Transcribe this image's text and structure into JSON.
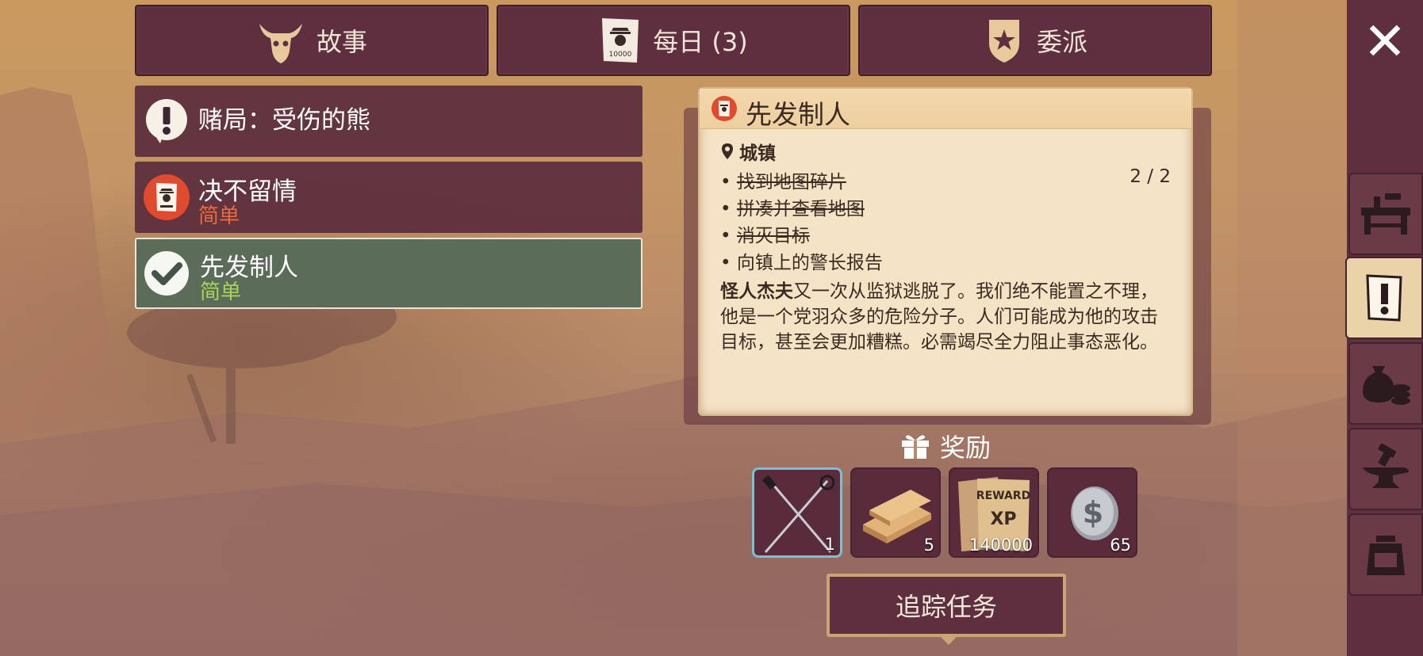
{
  "tabs": [
    {
      "label": "故事",
      "icon": "bull-skull-icon"
    },
    {
      "label": "每日 (3)",
      "icon": "wanted-poster-icon"
    },
    {
      "label": "委派",
      "icon": "sheriff-badge-icon"
    }
  ],
  "close": {
    "symbol": "✕"
  },
  "quests": [
    {
      "title": "赌局：受伤的熊",
      "subtitle": "",
      "icon": "exclamation-icon",
      "state": "normal"
    },
    {
      "title": "决不留情",
      "subtitle": "简单",
      "subtitle_color": "#e96a3e",
      "icon": "wanted-poster-icon",
      "state": "normal"
    },
    {
      "title": "先发制人",
      "subtitle": "简单",
      "subtitle_color": "#a9d45a",
      "icon": "checkmark-icon",
      "state": "selected"
    }
  ],
  "detail": {
    "title": "先发制人",
    "location": "城镇",
    "objectives": [
      {
        "text": "找到地图碎片",
        "done": true
      },
      {
        "text": "拼凑并查看地图",
        "done": true
      },
      {
        "text": "消灭目标",
        "done": true
      },
      {
        "text": "向镇上的警长报告",
        "done": false
      }
    ],
    "objective_count": "2 / 2",
    "description_name": "怪人杰夫",
    "description_rest": "又一次从监狱逃脱了。我们绝不能置之不理，他是一个党羽众多的危险分子。人们可能成为他的攻击目标，甚至会更加糟糕。必需竭尽全力阻止事态恶化。"
  },
  "rewards": {
    "label": "奖励",
    "items": [
      {
        "name": "sabers-icon",
        "qty": "1"
      },
      {
        "name": "wood-planks-icon",
        "qty": "5"
      },
      {
        "name": "xp-reward-poster-icon",
        "qty": "140000"
      },
      {
        "name": "silver-dollar-coin-icon",
        "qty": "65"
      }
    ]
  },
  "track_button": {
    "label": "追踪任务"
  },
  "side_tabs": [
    {
      "name": "workbench-icon",
      "active": false
    },
    {
      "name": "quest-exclamation-icon",
      "active": true
    },
    {
      "name": "money-bag-icon",
      "active": false
    },
    {
      "name": "anvil-icon",
      "active": false
    },
    {
      "name": "backpack-icon",
      "active": false
    }
  ],
  "colors": {
    "panel": "#5e2f3f",
    "selected": "#5b6c58",
    "card": "#f5e3c6",
    "accent_easy_orange": "#e96a3e",
    "accent_easy_green": "#a9d45a"
  }
}
